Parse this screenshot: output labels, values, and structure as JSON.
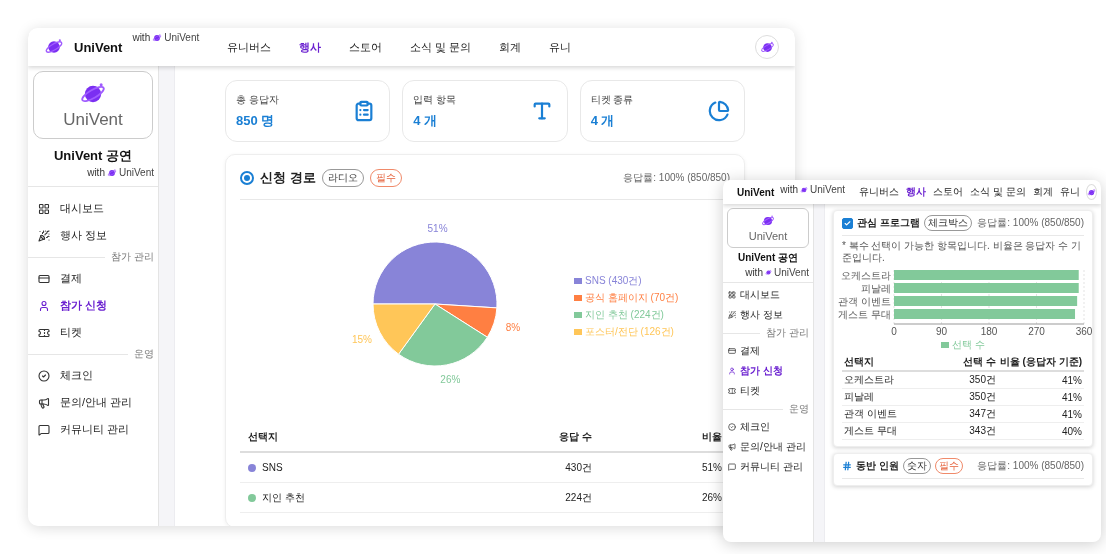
{
  "main": {
    "header": {
      "logo": "UniVent",
      "with_label": "with",
      "with_logo": "UniVent",
      "nav": [
        {
          "label": "유니버스",
          "selected": false
        },
        {
          "label": "행사",
          "selected": true
        },
        {
          "label": "스토어",
          "selected": false
        },
        {
          "label": "소식 및 문의",
          "selected": false
        },
        {
          "label": "회계",
          "selected": false
        },
        {
          "label": "유니",
          "selected": false
        }
      ]
    },
    "sidebar": {
      "brand": "UniVent",
      "title": "UniVent 공연",
      "with_label": "with",
      "with_logo": "UniVent",
      "items": [
        {
          "kind": "item",
          "label": "대시보드",
          "selected": false
        },
        {
          "kind": "item",
          "label": "행사 정보",
          "selected": false
        },
        {
          "kind": "section",
          "label": "참가 관리"
        },
        {
          "kind": "item",
          "label": "결제",
          "selected": false
        },
        {
          "kind": "item",
          "label": "참가 신청",
          "selected": true
        },
        {
          "kind": "item",
          "label": "티켓",
          "selected": false
        },
        {
          "kind": "section",
          "label": "운영"
        },
        {
          "kind": "item",
          "label": "체크인",
          "selected": false
        },
        {
          "kind": "item",
          "label": "문의/안내 관리",
          "selected": false
        },
        {
          "kind": "item",
          "label": "커뮤니티 관리",
          "selected": false
        }
      ]
    },
    "stats": [
      {
        "label": "총 응답자",
        "value": "850 명"
      },
      {
        "label": "입력 항목",
        "value": "4 개"
      },
      {
        "label": "티켓 종류",
        "value": "4 개"
      }
    ],
    "question": {
      "kind": "radio",
      "title": "신청 경로",
      "tags": [
        {
          "label": "라디오",
          "kind": "type"
        },
        {
          "label": "필수",
          "kind": "required"
        }
      ],
      "response_rate": "응답률: 100% (850/850)",
      "chart_data": {
        "type": "pie",
        "categories": [
          "SNS (430건)",
          "공식 홈페이지 (70건)",
          "지인 추천 (224건)",
          "포스터/전단 (126건)"
        ],
        "colors": [
          "#8884d8",
          "#ff7f42",
          "#82c99a",
          "#ffc658"
        ],
        "series": [
          {
            "values": [
              51,
              8,
              26,
              15
            ]
          }
        ],
        "value_labels": [
          "51%",
          "8%",
          "26%",
          "15%"
        ]
      },
      "table": {
        "columns": [
          "선택지",
          "응답 수",
          "비율"
        ],
        "rows": [
          {
            "choice": "SNS",
            "color": "#8884d8",
            "count": "430건",
            "ratio": "51%"
          },
          {
            "choice": "지인 추천",
            "color": "#82c99a",
            "count": "224건",
            "ratio": "26%"
          }
        ]
      }
    }
  },
  "inset": {
    "header": {
      "logo": "UniVent",
      "with_label": "with",
      "with_logo": "UniVent",
      "nav": [
        {
          "label": "유니버스",
          "selected": false
        },
        {
          "label": "행사",
          "selected": true
        },
        {
          "label": "스토어",
          "selected": false
        },
        {
          "label": "소식 및 문의",
          "selected": false
        },
        {
          "label": "회계",
          "selected": false
        },
        {
          "label": "유니",
          "selected": false
        }
      ]
    },
    "sidebar": {
      "brand": "UniVent",
      "title": "UniVent 공연",
      "with_label": "with",
      "with_logo": "UniVent",
      "items": [
        {
          "kind": "item",
          "label": "대시보드",
          "selected": false
        },
        {
          "kind": "item",
          "label": "행사 정보",
          "selected": false
        },
        {
          "kind": "section",
          "label": "참가 관리"
        },
        {
          "kind": "item",
          "label": "결제",
          "selected": false
        },
        {
          "kind": "item",
          "label": "참가 신청",
          "selected": true
        },
        {
          "kind": "item",
          "label": "티켓",
          "selected": false
        },
        {
          "kind": "section",
          "label": "운영"
        },
        {
          "kind": "item",
          "label": "체크인",
          "selected": false
        },
        {
          "kind": "item",
          "label": "문의/안내 관리",
          "selected": false
        },
        {
          "kind": "item",
          "label": "커뮤니티 관리",
          "selected": false
        }
      ]
    },
    "questions": [
      {
        "kind": "checkbox",
        "checked": true,
        "title": "관심 프로그램",
        "tags": [
          {
            "label": "체크박스",
            "kind": "type"
          }
        ],
        "response_rate": "응답률: 100% (850/850)",
        "note": "* 복수 선택이 가능한 항목입니다. 비율은 응답자 수 기준입니다.",
        "chart_data": {
          "type": "bar",
          "orientation": "horizontal",
          "grid": true,
          "categories": [
            "오케스트라",
            "피날레",
            "관객 이벤트",
            "게스트 무대"
          ],
          "series": [
            {
              "name": "선택 수",
              "color": "#82c99a",
              "values": [
                350,
                350,
                347,
                343
              ]
            }
          ],
          "xlim": [
            0,
            360
          ],
          "xticks": [
            0,
            90,
            180,
            270,
            360
          ]
        },
        "table": {
          "columns": [
            "선택지",
            "선택 수",
            "비율 (응답자 기준)"
          ],
          "rows": [
            {
              "choice": "오케스트라",
              "count": "350건",
              "ratio": "41%"
            },
            {
              "choice": "피날레",
              "count": "350건",
              "ratio": "41%"
            },
            {
              "choice": "관객 이벤트",
              "count": "347건",
              "ratio": "41%"
            },
            {
              "choice": "게스트 무대",
              "count": "343건",
              "ratio": "40%"
            }
          ]
        }
      },
      {
        "kind": "number",
        "title": "동반 인원",
        "tags": [
          {
            "label": "숫자",
            "kind": "type"
          },
          {
            "label": "필수",
            "kind": "required"
          }
        ],
        "response_rate": "응답률: 100% (850/850)"
      }
    ]
  }
}
